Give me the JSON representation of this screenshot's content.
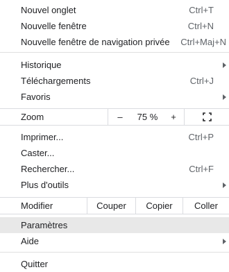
{
  "menu": {
    "new_tab": {
      "label": "Nouvel onglet",
      "shortcut": "Ctrl+T"
    },
    "new_window": {
      "label": "Nouvelle fenêtre",
      "shortcut": "Ctrl+N"
    },
    "new_incognito": {
      "label": "Nouvelle fenêtre de navigation privée",
      "shortcut": "Ctrl+Maj+N"
    },
    "history": {
      "label": "Historique"
    },
    "downloads": {
      "label": "Téléchargements",
      "shortcut": "Ctrl+J"
    },
    "bookmarks": {
      "label": "Favoris"
    },
    "zoom": {
      "label": "Zoom",
      "minus": "–",
      "level": "75 %",
      "plus": "+",
      "fullscreen_icon": "fullscreen-icon"
    },
    "print": {
      "label": "Imprimer...",
      "shortcut": "Ctrl+P"
    },
    "cast": {
      "label": "Caster..."
    },
    "find": {
      "label": "Rechercher...",
      "shortcut": "Ctrl+F"
    },
    "more_tools": {
      "label": "Plus d'outils"
    },
    "edit": {
      "label": "Modifier",
      "cut": "Couper",
      "copy": "Copier",
      "paste": "Coller"
    },
    "settings": {
      "label": "Paramètres"
    },
    "help": {
      "label": "Aide"
    },
    "quit": {
      "label": "Quitter"
    }
  },
  "colors": {
    "highlight": "#e8e8e8",
    "separator": "#e0e0e0",
    "text": "#202124",
    "shortcut": "#5f6368"
  }
}
